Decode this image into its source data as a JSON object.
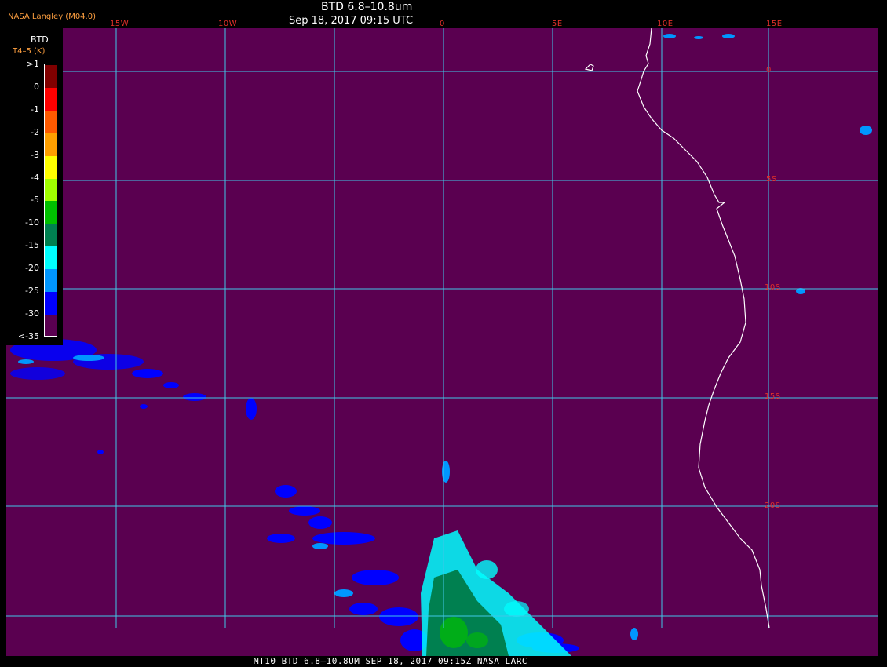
{
  "header": {
    "title": "BTD 6.8–10.8um",
    "datetime": "Sep 18, 2017 09:15 UTC",
    "credit": "NASA Langley (M04.0)"
  },
  "legend": {
    "title": "BTD",
    "subtitle": "T4–5 (K)",
    "labels": [
      ">1",
      "0",
      "-1",
      "-2",
      "-3",
      "-4",
      "-5",
      "-10",
      "-15",
      "-20",
      "-25",
      "-30",
      "<-35"
    ],
    "colors": [
      "#800000",
      "#ff0000",
      "#ff5a00",
      "#ff9f00",
      "#ffff00",
      "#a0ff00",
      "#00c000",
      "#008050",
      "#00ffff",
      "#0096ff",
      "#0000ff",
      "#5a0050"
    ]
  },
  "grid": {
    "lon_labels": [
      "15W",
      "10W",
      "0",
      "5E",
      "10E",
      "15E"
    ],
    "lat_labels": [
      "0",
      "5S",
      "10S",
      "15S",
      "20S"
    ]
  },
  "footer": {
    "text": "MT10  BTD 6.8–10.8UM   SEP 18, 2017 09:15Z   NASA LARC"
  },
  "colors": {
    "background": "#5a0050",
    "grid": "#40c8e8",
    "coast": "#ffffff",
    "label": "#e0302a"
  }
}
